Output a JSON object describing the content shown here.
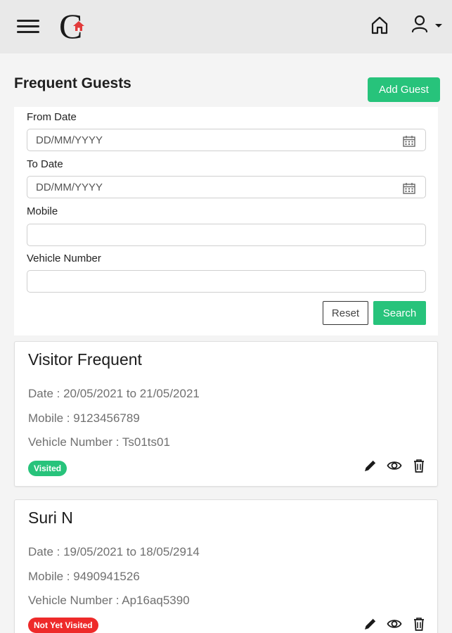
{
  "header": {
    "menu_icon": "hamburger-menu-icon",
    "logo_letter": "C",
    "home_icon": "home-icon",
    "user_icon": "user-icon",
    "brand_color": "#27c37b"
  },
  "page": {
    "title": "Frequent Guests",
    "add_guest_label": "Add Guest"
  },
  "filters": {
    "from_date": {
      "label": "From Date",
      "placeholder": "DD/MM/YYYY",
      "value": ""
    },
    "to_date": {
      "label": "To Date",
      "placeholder": "DD/MM/YYYY",
      "value": ""
    },
    "mobile": {
      "label": "Mobile",
      "placeholder": "",
      "value": ""
    },
    "vehicle_number": {
      "label": "Vehicle Number",
      "placeholder": "",
      "value": ""
    },
    "reset_label": "Reset",
    "search_label": "Search"
  },
  "guests": [
    {
      "name": "Visitor Frequent",
      "date": "Date : 20/05/2021 to 21/05/2021",
      "mobile": "Mobile : 9123456789",
      "vehicle": "Vehicle Number : Ts01ts01",
      "status": "Visited",
      "status_color": "#27c37b"
    },
    {
      "name": "Suri N",
      "date": "Date : 19/05/2021 to 18/05/2914",
      "mobile": "Mobile : 9490941526",
      "vehicle": "Vehicle Number : Ap16aq5390",
      "status": "Not Yet Visited",
      "status_color": "#ee2a2a"
    }
  ]
}
